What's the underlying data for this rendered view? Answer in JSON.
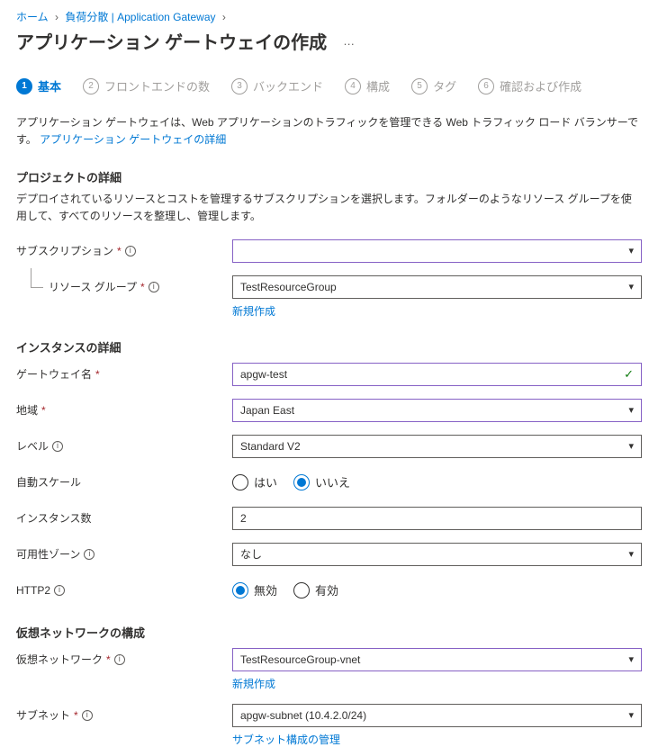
{
  "breadcrumb": {
    "home": "ホーム",
    "item2": "負荷分散 | Application Gateway"
  },
  "page_title": "アプリケーション ゲートウェイの作成",
  "page_title_more": "…",
  "tabs": [
    {
      "num": "1",
      "label": "基本"
    },
    {
      "num": "2",
      "label": "フロントエンドの数"
    },
    {
      "num": "3",
      "label": "バックエンド"
    },
    {
      "num": "4",
      "label": "構成"
    },
    {
      "num": "5",
      "label": "タグ"
    },
    {
      "num": "6",
      "label": "確認および作成"
    }
  ],
  "intro": {
    "text": "アプリケーション ゲートウェイは、Web アプリケーションのトラフィックを管理できる Web トラフィック ロード バランサーです。 ",
    "link": "アプリケーション ゲートウェイの詳細"
  },
  "project": {
    "title": "プロジェクトの詳細",
    "desc": "デプロイされているリソースとコストを管理するサブスクリプションを選択します。フォルダーのようなリソース グループを使用して、すべてのリソースを整理し、管理します。",
    "subscription_label": "サブスクリプション",
    "subscription_value": "",
    "rg_label": "リソース グループ",
    "rg_value": "TestResourceGroup",
    "rg_new": "新規作成"
  },
  "instance": {
    "title": "インスタンスの詳細",
    "name_label": "ゲートウェイ名",
    "name_value": "apgw-test",
    "region_label": "地域",
    "region_value": "Japan East",
    "tier_label": "レベル",
    "tier_value": "Standard V2",
    "autoscale_label": "自動スケール",
    "autoscale_yes": "はい",
    "autoscale_no": "いいえ",
    "count_label": "インスタンス数",
    "count_value": "2",
    "zone_label": "可用性ゾーン",
    "zone_value": "なし",
    "http2_label": "HTTP2",
    "http2_off": "無効",
    "http2_on": "有効"
  },
  "vnet": {
    "title": "仮想ネットワークの構成",
    "net_label": "仮想ネットワーク",
    "net_value": "TestResourceGroup-vnet",
    "net_new": "新規作成",
    "subnet_label": "サブネット",
    "subnet_value": "apgw-subnet (10.4.2.0/24)",
    "subnet_manage": "サブネット構成の管理"
  }
}
